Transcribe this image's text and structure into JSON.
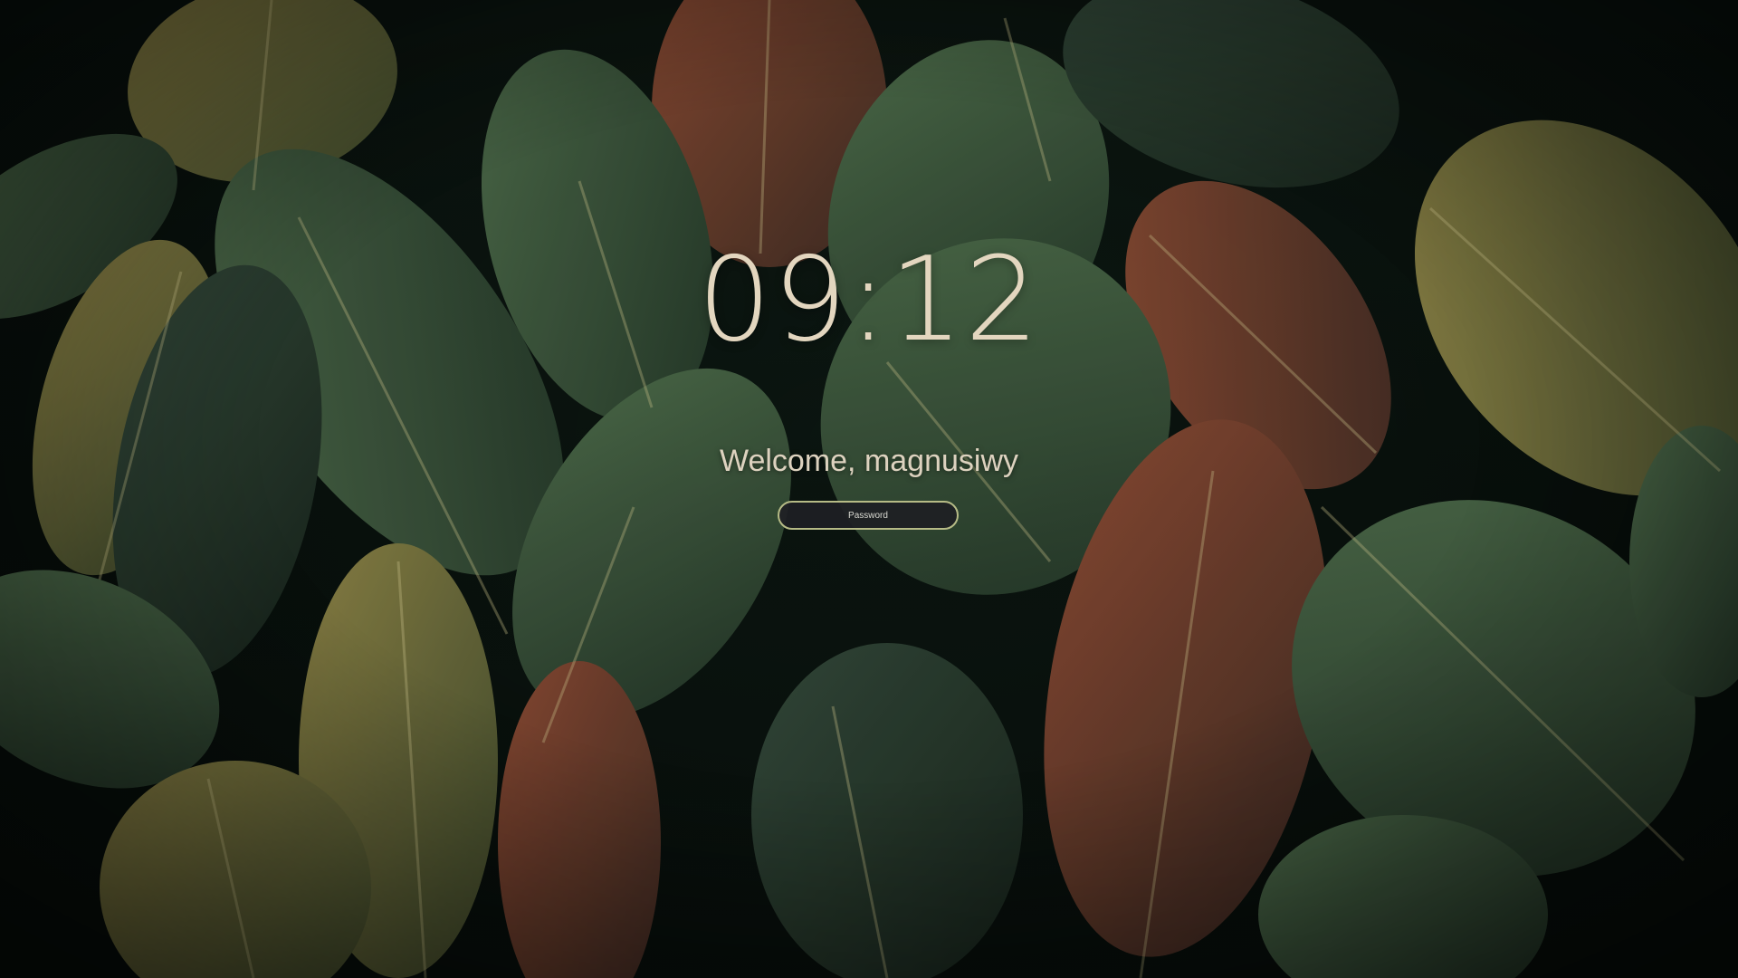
{
  "lockscreen": {
    "time": "09:12",
    "welcome": "Welcome, magnusiwy",
    "password": {
      "placeholder": "Password",
      "value": ""
    }
  },
  "wallpaper": {
    "subject": "tropical fern leaves",
    "colors": {
      "background": "#0b1410",
      "leaf_green": "#3f5a3e",
      "leaf_dark": "#2b3f2d",
      "leaf_olive": "#7a7440",
      "leaf_rust": "#7a3a2b",
      "text": "#e3d6bf",
      "field_border": "#b6bb86"
    }
  }
}
